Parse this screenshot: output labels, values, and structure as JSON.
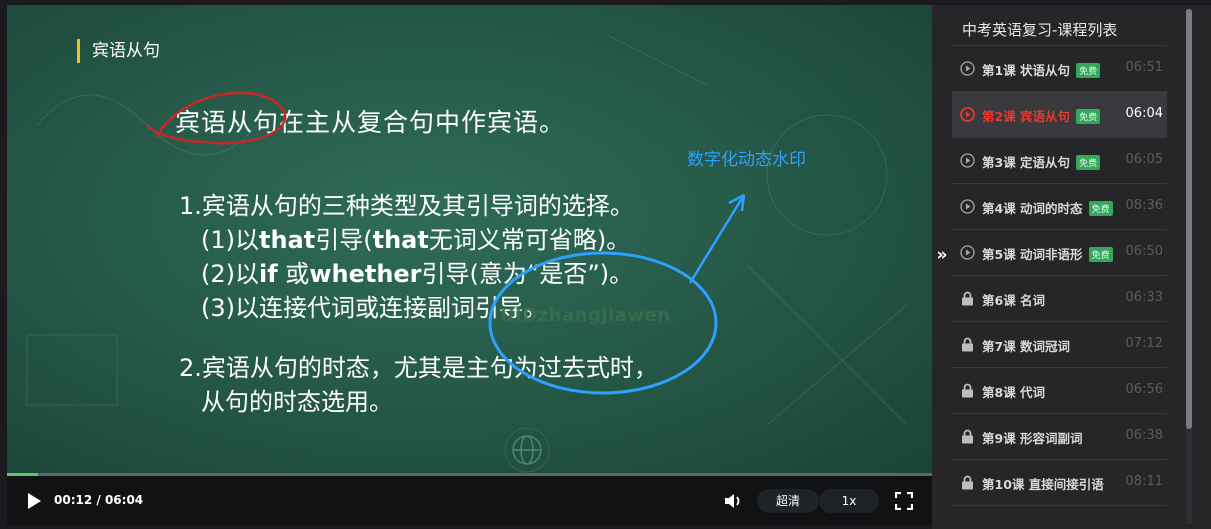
{
  "slide": {
    "title": "宾语从句",
    "main_line": "宾语从句在主从复合句中作宾语。",
    "point1_num": "1.",
    "point1_text": "宾语从句的三种类型及其引导词的选择。",
    "sub1_a": "(1)以",
    "sub1_b": "that",
    "sub1_c": "引导(",
    "sub1_d": "that",
    "sub1_e": "无词义常可省略)。",
    "sub2_a": "(2)以",
    "sub2_b": "if",
    "sub2_c": " 或",
    "sub2_d": "whether",
    "sub2_e": "引导(意为“是否”)。",
    "sub3": "(3)以连接代词或连接副词引导。",
    "point2_num": "2.",
    "point2_text": "宾语从句的时态，尤其是主句为过去式时，",
    "point2_text2": "从句的时态选用。",
    "watermark": "UIDzhangjiawen",
    "annotation": "数字化动态水印"
  },
  "player": {
    "current_time": "00:12",
    "separator": " / ",
    "duration": "06:04",
    "progress_fraction": 0.033,
    "quality": "超清",
    "speed": "1x"
  },
  "sidebar": {
    "title": "中考英语复习-课程列表",
    "collapse_glyph": "»",
    "badge_text": "免费",
    "items": [
      {
        "label": "第1课 状语从句",
        "duration": "06:51",
        "free": true,
        "locked": false,
        "active": false
      },
      {
        "label": "第2课 宾语从句",
        "duration": "06:04",
        "free": true,
        "locked": false,
        "active": true
      },
      {
        "label": "第3课 定语从句",
        "duration": "06:05",
        "free": true,
        "locked": false,
        "active": false
      },
      {
        "label": "第4课 动词的时态",
        "duration": "08:36",
        "free": true,
        "locked": false,
        "active": false
      },
      {
        "label": "第5课 动词非语形",
        "duration": "06:50",
        "free": true,
        "locked": false,
        "active": false
      },
      {
        "label": "第6课 名词",
        "duration": "06:33",
        "free": false,
        "locked": true,
        "active": false
      },
      {
        "label": "第7课 数词冠词",
        "duration": "07:12",
        "free": false,
        "locked": true,
        "active": false
      },
      {
        "label": "第8课 代词",
        "duration": "06:56",
        "free": false,
        "locked": true,
        "active": false
      },
      {
        "label": "第9课 形容词副词",
        "duration": "06:38",
        "free": false,
        "locked": true,
        "active": false
      },
      {
        "label": "第10课 直接间接引语",
        "duration": "08:11",
        "free": false,
        "locked": true,
        "active": false
      }
    ]
  },
  "colors": {
    "accent_red": "#e8372b",
    "badge_green": "#34a85a",
    "annotation_blue": "#2ea0ff",
    "title_bar_yellow": "#f2c026"
  }
}
